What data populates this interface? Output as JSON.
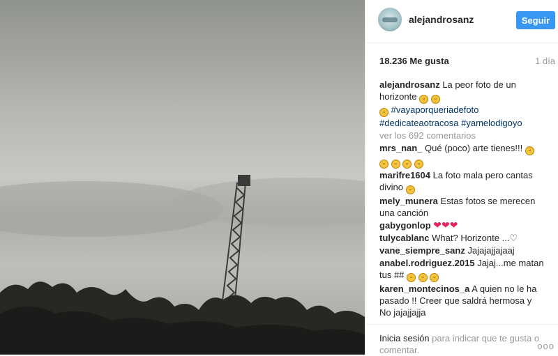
{
  "post": {
    "username": "alejandrosanz",
    "follow_label": "Seguir",
    "likes": "18.236 Me gusta",
    "time": "1 día"
  },
  "comments": [
    {
      "user": "alejandrosanz",
      "text": "La peor foto de un horizonte",
      "tags": [
        "#vayaporqueriadefoto",
        "#dedicateaotracosa",
        "#yamelodigoyo"
      ]
    },
    {
      "more": "ver los 692 comentarios"
    },
    {
      "user": "mrs_nan_",
      "text": "Qué (poco) arte tienes!!!"
    },
    {
      "user": "marifre1604",
      "text": "La foto mala pero cantas divino"
    },
    {
      "user": "mely_munera",
      "text": "Estas fotos se merecen una canción"
    },
    {
      "user": "gabygonlop",
      "text": ""
    },
    {
      "user": "tulycablanc",
      "text": "What? Horizonte ...♡"
    },
    {
      "user": "vane_siempre_sanz",
      "text": "Jajajajjajaaj"
    },
    {
      "user": "anabel.rodriguez.2015",
      "text": "Jajaj...me matan tus ##"
    },
    {
      "user": "karen_montecinos_a",
      "text": "A quien no le ha pasado !! Creer que saldrá hermosa y No jajajjajja"
    }
  ],
  "footer": {
    "login_link": "Inicia sesión",
    "prompt": "para indicar que te gusta o comentar.",
    "more_icon": "ellipsis-icon"
  },
  "colors": {
    "accent": "#3897f0",
    "hashtag": "#003569",
    "muted": "#999999"
  }
}
